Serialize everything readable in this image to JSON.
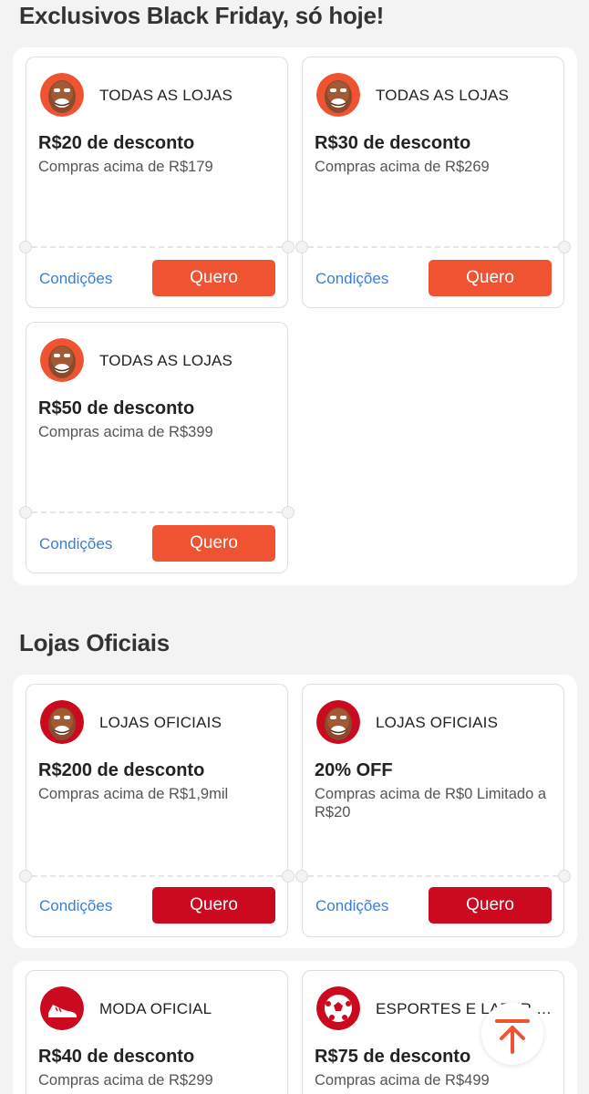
{
  "sections": [
    {
      "title": "Exclusivos Black Friday, só hoje!",
      "coupons": [
        {
          "store": "TODAS AS LOJAS",
          "amount": "R$20 de desconto",
          "condition": "Compras acima de R$179",
          "link": "Condições",
          "button": "Quero"
        },
        {
          "store": "TODAS AS LOJAS",
          "amount": "R$30 de desconto",
          "condition": "Compras acima de R$269",
          "link": "Condições",
          "button": "Quero"
        },
        {
          "store": "TODAS AS LOJAS",
          "amount": "R$50 de desconto",
          "condition": "Compras acima de R$399",
          "link": "Condições",
          "button": "Quero"
        }
      ]
    },
    {
      "title": "Lojas Oficiais",
      "coupons": [
        {
          "store": "LOJAS OFICIAIS",
          "amount": "R$200 de desconto",
          "condition": "Compras acima de R$1,9mil",
          "link": "Condições",
          "button": "Quero"
        },
        {
          "store": "LOJAS OFICIAIS",
          "amount": "20% OFF",
          "condition": "Compras acima de R$0 Limitado a R$20",
          "link": "Condições",
          "button": "Quero"
        },
        {
          "store": "MODA OFICIAL",
          "amount": "R$40 de desconto",
          "condition": "Compras acima de R$299"
        },
        {
          "store": "ESPORTES E LAZER OF...",
          "amount": "R$75 de desconto",
          "condition": "Compras acima de R$499"
        }
      ]
    }
  ],
  "icons": {
    "store_avatar": "man-face-avatar",
    "moda": "sneaker-icon",
    "esportes": "soccer-ball-icon",
    "fab": "scroll-to-top-icon"
  },
  "colors": {
    "orange_button": "#ef5331",
    "red_button": "#cc0a1f",
    "link": "#3b7dd8",
    "background": "#f3f3f3"
  }
}
